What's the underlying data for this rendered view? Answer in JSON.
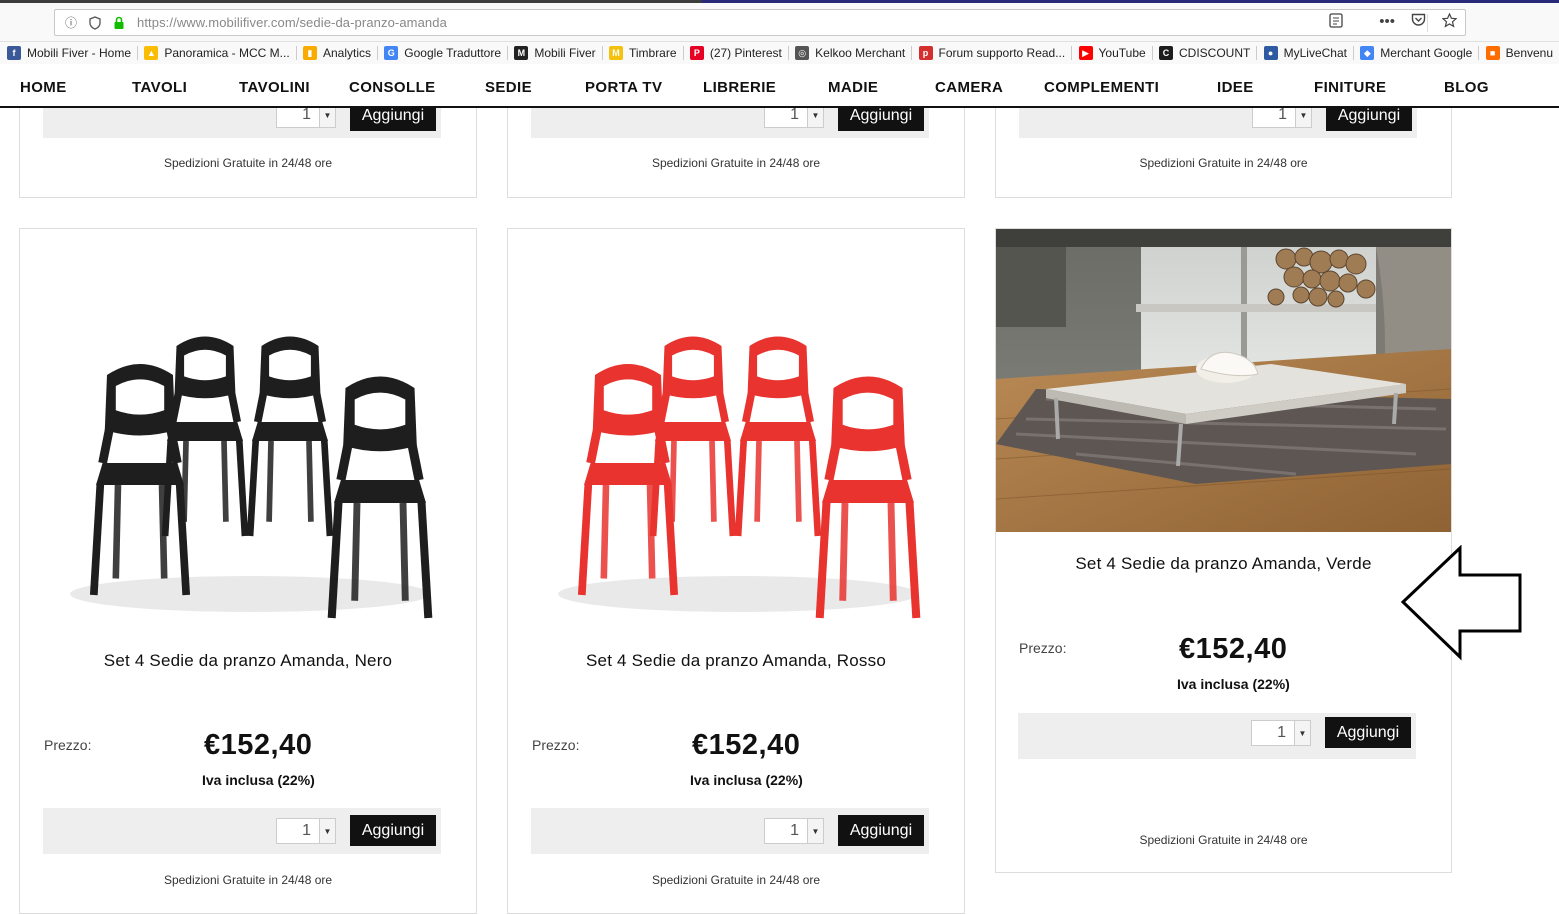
{
  "browser": {
    "url_host": "https://www.mobilifiver.com",
    "url_path": "/sedie-da-pranzo-amanda"
  },
  "bookmarks": [
    {
      "label": "Mobili Fiver - Home",
      "color": "#3b5998",
      "glyph": "f"
    },
    {
      "label": "Panoramica - MCC M...",
      "color": "#fbbc04",
      "glyph": "▲"
    },
    {
      "label": "Analytics",
      "color": "#f9ab00",
      "glyph": "▮"
    },
    {
      "label": "Google Traduttore",
      "color": "#4285f4",
      "glyph": "G"
    },
    {
      "label": "Mobili Fiver",
      "color": "#222222",
      "glyph": "M"
    },
    {
      "label": "Timbrare",
      "color": "#f4c20d",
      "glyph": "M"
    },
    {
      "label": "(27) Pinterest",
      "color": "#e60023",
      "glyph": "P"
    },
    {
      "label": "Kelkoo Merchant",
      "color": "#555555",
      "glyph": "◎"
    },
    {
      "label": "Forum supporto Read...",
      "color": "#d32f2f",
      "glyph": "p"
    },
    {
      "label": "YouTube",
      "color": "#ff0000",
      "glyph": "▶"
    },
    {
      "label": "CDISCOUNT",
      "color": "#1c1c1c",
      "glyph": "C"
    },
    {
      "label": "MyLiveChat",
      "color": "#2d5aa0",
      "glyph": "●"
    },
    {
      "label": "Merchant Google",
      "color": "#4285f4",
      "glyph": "◆"
    },
    {
      "label": "Benvenu",
      "color": "#ff6d00",
      "glyph": "■"
    }
  ],
  "nav": [
    "HOME",
    "TAVOLI",
    "TAVOLINI",
    "CONSOLLE",
    "SEDIE",
    "PORTA TV",
    "LIBRERIE",
    "MADIE",
    "CAMERA",
    "COMPLEMENTI",
    "IDEE",
    "FINITURE",
    "BLOG"
  ],
  "common": {
    "price_label": "Prezzo:",
    "vat": "Iva inclusa (22%)",
    "add": "Aggiungi",
    "qty": "1",
    "shipping": "Spedizioni Gratuite in 24/48 ore"
  },
  "products": [
    {
      "title": "Set 4 Sedie da pranzo Amanda, Nero",
      "price": "€152,40",
      "chair_color": "#1e1e1e"
    },
    {
      "title": "Set 4 Sedie da pranzo Amanda, Rosso",
      "price": "€152,40",
      "chair_color": "#e8332f"
    },
    {
      "title": "Set 4 Sedie da pranzo Amanda, Verde",
      "price": "€152,40"
    }
  ]
}
